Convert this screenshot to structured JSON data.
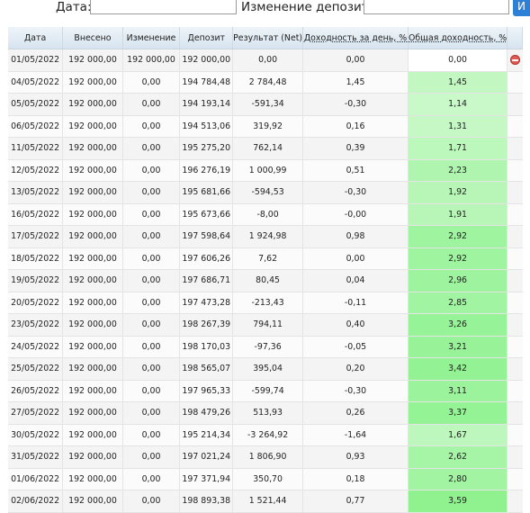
{
  "form": {
    "date_label": "Дата:",
    "date_value": "",
    "deposit_change_label": "Изменение депозита:",
    "deposit_change_value": "",
    "submit_label": "И"
  },
  "table": {
    "columns": [
      "Дата",
      "Внесено",
      "Изменение",
      "Депозит",
      "Результат (Net)",
      "Доходность за день, %",
      "Общая доходность, %"
    ],
    "rows": [
      {
        "date": "01/05/2022",
        "deposited": "192 000,00",
        "change": "192 000,00",
        "deposit": "192 000,00",
        "result": "0,00",
        "day_pct": "0,00",
        "total_pct": "0,00",
        "total_value": 0.0,
        "deletable": true
      },
      {
        "date": "04/05/2022",
        "deposited": "192 000,00",
        "change": "0,00",
        "deposit": "194 784,48",
        "result": "2 784,48",
        "day_pct": "1,45",
        "total_pct": "1,45",
        "total_value": 1.45
      },
      {
        "date": "05/05/2022",
        "deposited": "192 000,00",
        "change": "0,00",
        "deposit": "194 193,14",
        "result": "-591,34",
        "day_pct": "-0,30",
        "total_pct": "1,14",
        "total_value": 1.14
      },
      {
        "date": "06/05/2022",
        "deposited": "192 000,00",
        "change": "0,00",
        "deposit": "194 513,06",
        "result": "319,92",
        "day_pct": "0,16",
        "total_pct": "1,31",
        "total_value": 1.31
      },
      {
        "date": "11/05/2022",
        "deposited": "192 000,00",
        "change": "0,00",
        "deposit": "195 275,20",
        "result": "762,14",
        "day_pct": "0,39",
        "total_pct": "1,71",
        "total_value": 1.71
      },
      {
        "date": "12/05/2022",
        "deposited": "192 000,00",
        "change": "0,00",
        "deposit": "196 276,19",
        "result": "1 000,99",
        "day_pct": "0,51",
        "total_pct": "2,23",
        "total_value": 2.23
      },
      {
        "date": "13/05/2022",
        "deposited": "192 000,00",
        "change": "0,00",
        "deposit": "195 681,66",
        "result": "-594,53",
        "day_pct": "-0,30",
        "total_pct": "1,92",
        "total_value": 1.92
      },
      {
        "date": "16/05/2022",
        "deposited": "192 000,00",
        "change": "0,00",
        "deposit": "195 673,66",
        "result": "-8,00",
        "day_pct": "-0,00",
        "total_pct": "1,91",
        "total_value": 1.91
      },
      {
        "date": "17/05/2022",
        "deposited": "192 000,00",
        "change": "0,00",
        "deposit": "197 598,64",
        "result": "1 924,98",
        "day_pct": "0,98",
        "total_pct": "2,92",
        "total_value": 2.92
      },
      {
        "date": "18/05/2022",
        "deposited": "192 000,00",
        "change": "0,00",
        "deposit": "197 606,26",
        "result": "7,62",
        "day_pct": "0,00",
        "total_pct": "2,92",
        "total_value": 2.92
      },
      {
        "date": "19/05/2022",
        "deposited": "192 000,00",
        "change": "0,00",
        "deposit": "197 686,71",
        "result": "80,45",
        "day_pct": "0,04",
        "total_pct": "2,96",
        "total_value": 2.96
      },
      {
        "date": "20/05/2022",
        "deposited": "192 000,00",
        "change": "0,00",
        "deposit": "197 473,28",
        "result": "-213,43",
        "day_pct": "-0,11",
        "total_pct": "2,85",
        "total_value": 2.85
      },
      {
        "date": "23/05/2022",
        "deposited": "192 000,00",
        "change": "0,00",
        "deposit": "198 267,39",
        "result": "794,11",
        "day_pct": "0,40",
        "total_pct": "3,26",
        "total_value": 3.26
      },
      {
        "date": "24/05/2022",
        "deposited": "192 000,00",
        "change": "0,00",
        "deposit": "198 170,03",
        "result": "-97,36",
        "day_pct": "-0,05",
        "total_pct": "3,21",
        "total_value": 3.21
      },
      {
        "date": "25/05/2022",
        "deposited": "192 000,00",
        "change": "0,00",
        "deposit": "198 565,07",
        "result": "395,04",
        "day_pct": "0,20",
        "total_pct": "3,42",
        "total_value": 3.42
      },
      {
        "date": "26/05/2022",
        "deposited": "192 000,00",
        "change": "0,00",
        "deposit": "197 965,33",
        "result": "-599,74",
        "day_pct": "-0,30",
        "total_pct": "3,11",
        "total_value": 3.11
      },
      {
        "date": "27/05/2022",
        "deposited": "192 000,00",
        "change": "0,00",
        "deposit": "198 479,26",
        "result": "513,93",
        "day_pct": "0,26",
        "total_pct": "3,37",
        "total_value": 3.37
      },
      {
        "date": "30/05/2022",
        "deposited": "192 000,00",
        "change": "0,00",
        "deposit": "195 214,34",
        "result": "-3 264,92",
        "day_pct": "-1,64",
        "total_pct": "1,67",
        "total_value": 1.67
      },
      {
        "date": "31/05/2022",
        "deposited": "192 000,00",
        "change": "0,00",
        "deposit": "197 021,24",
        "result": "1 806,90",
        "day_pct": "0,93",
        "total_pct": "2,62",
        "total_value": 2.62
      },
      {
        "date": "01/06/2022",
        "deposited": "192 000,00",
        "change": "0,00",
        "deposit": "197 371,94",
        "result": "350,70",
        "day_pct": "0,18",
        "total_pct": "2,80",
        "total_value": 2.8
      },
      {
        "date": "02/06/2022",
        "deposited": "192 000,00",
        "change": "0,00",
        "deposit": "198 893,38",
        "result": "1 521,44",
        "day_pct": "0,77",
        "total_pct": "3,59",
        "total_value": 3.59
      }
    ]
  },
  "colors": {
    "positive_light": "#e4fbe4",
    "positive_strong": "#8ff28f",
    "submit_button": "#2e7fd6",
    "delete_icon": "#e05a55"
  }
}
